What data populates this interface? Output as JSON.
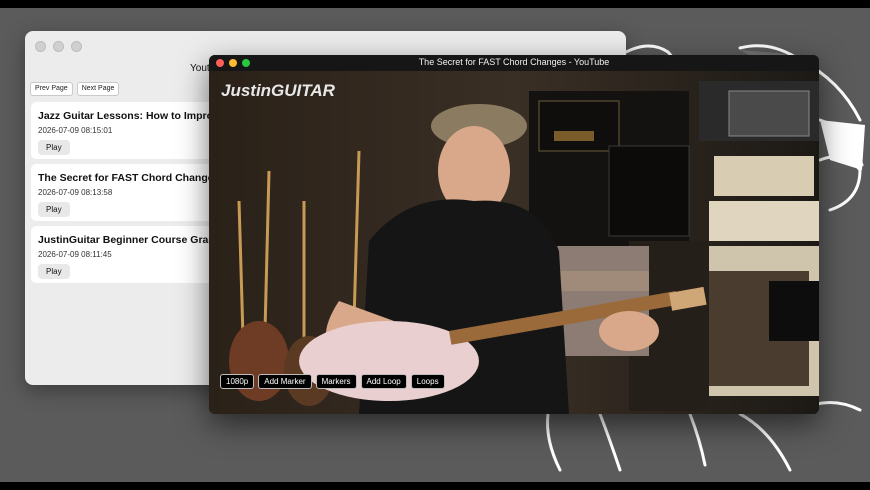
{
  "list_window": {
    "title": "Yout",
    "prev_label": "Prev Page",
    "next_label": "Next Page",
    "items": [
      {
        "title": "Jazz Guitar Lessons: How to Improvis",
        "date": "2026-07-09 08:15:01",
        "play": "Play"
      },
      {
        "title": "The Secret for FAST Chord Changes -",
        "date": "2026-07-09 08:13:58",
        "play": "Play"
      },
      {
        "title": "JustinGuitar Beginner Course Grade 1",
        "date": "2026-07-09 08:11:45",
        "play": "Play"
      }
    ]
  },
  "video_window": {
    "title": "The Secret for FAST Chord Changes - YouTube",
    "logo": "JustinGUITAR",
    "controls": {
      "quality": "1080p",
      "add_marker": "Add Marker",
      "markers": "Markers",
      "add_loop": "Add Loop",
      "loops": "Loops"
    }
  }
}
